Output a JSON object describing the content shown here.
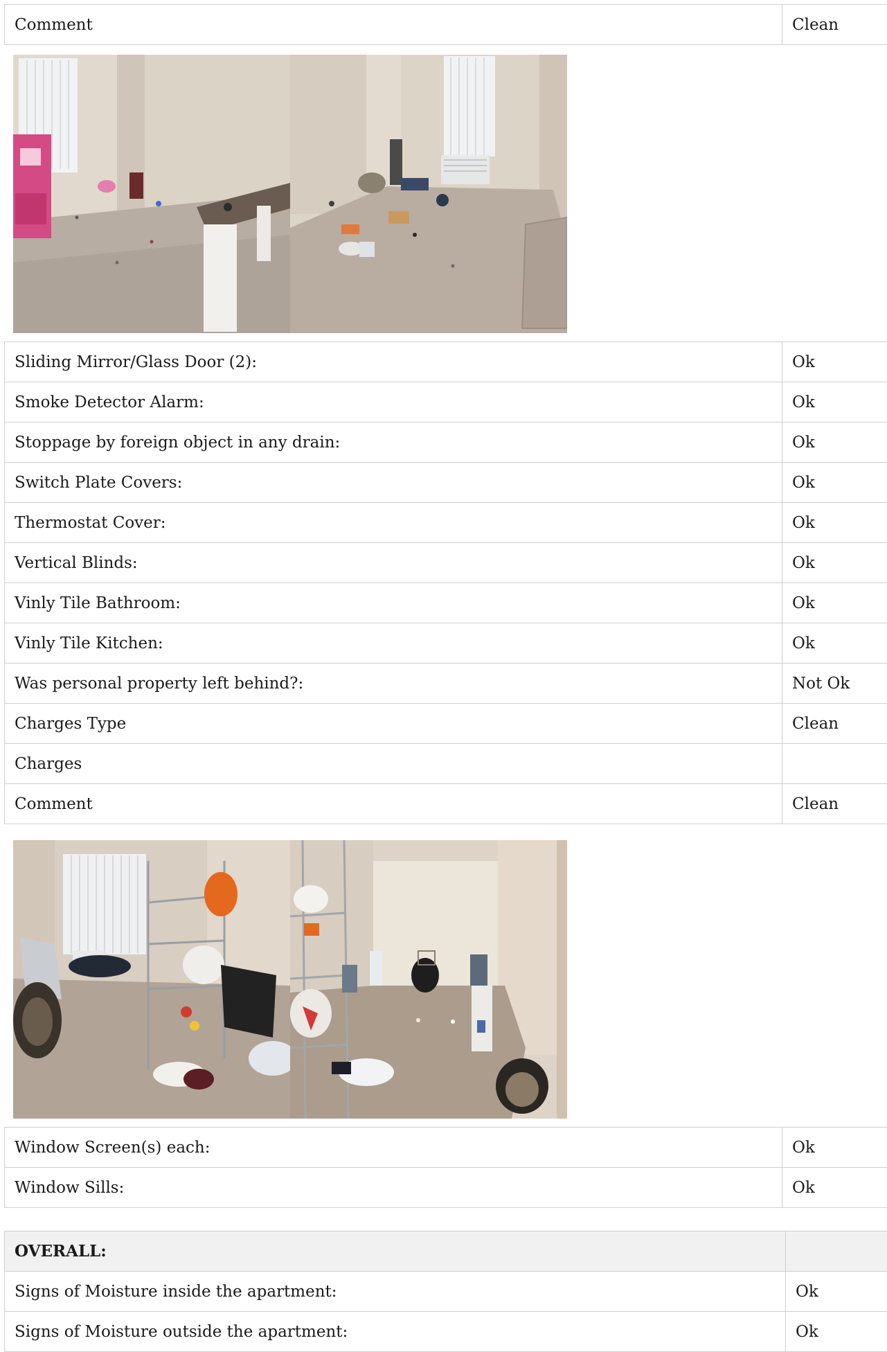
{
  "section_a": {
    "rows": [
      {
        "label": "Comment",
        "value": "Clean"
      }
    ]
  },
  "section_b": {
    "rows": [
      {
        "label": "Sliding Mirror/Glass Door (2):",
        "value": "Ok"
      },
      {
        "label": "Smoke Detector Alarm:",
        "value": "Ok"
      },
      {
        "label": "Stoppage by foreign object in any drain:",
        "value": "Ok"
      },
      {
        "label": "Switch Plate Covers:",
        "value": "Ok"
      },
      {
        "label": "Thermostat Cover:",
        "value": "Ok"
      },
      {
        "label": "Vertical Blinds:",
        "value": "Ok"
      },
      {
        "label": "Vinly Tile Bathroom:",
        "value": "Ok"
      },
      {
        "label": "Vinly Tile Kitchen:",
        "value": "Ok"
      },
      {
        "label": "Was personal property left behind?:",
        "value": "Not Ok"
      },
      {
        "label": "Charges Type",
        "value": "Clean"
      },
      {
        "label": "Charges",
        "value": ""
      },
      {
        "label": "Comment",
        "value": "Clean"
      }
    ]
  },
  "section_c": {
    "rows": [
      {
        "label": "Window Screen(s) each:",
        "value": "Ok"
      },
      {
        "label": "Window Sills:",
        "value": "Ok"
      }
    ]
  },
  "overall": {
    "heading": "OVERALL:",
    "rows": [
      {
        "label": "Signs of Moisture inside the apartment:",
        "value": "Ok"
      },
      {
        "label": "Signs of Moisture outside the apartment:",
        "value": "Ok"
      }
    ]
  },
  "photos": {
    "group_1": [
      "room-photo",
      "room-photo"
    ],
    "group_2": [
      "room-photo",
      "room-photo"
    ]
  }
}
